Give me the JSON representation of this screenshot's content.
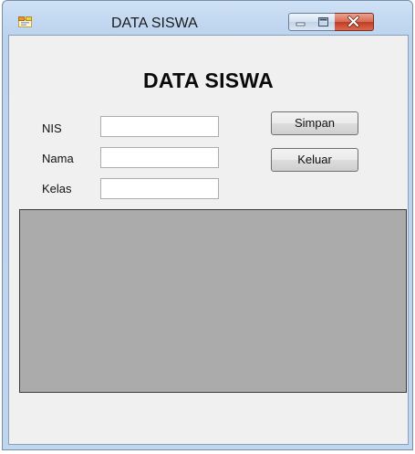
{
  "window": {
    "title": "DATA SISWA"
  },
  "form": {
    "heading": "DATA SISWA",
    "fields": [
      {
        "label": "NIS",
        "value": ""
      },
      {
        "label": "Nama",
        "value": ""
      },
      {
        "label": "Kelas",
        "value": ""
      }
    ],
    "buttons": {
      "save": "Simpan",
      "exit": "Keluar"
    }
  },
  "colors": {
    "grid_background": "#ababab",
    "form_background": "#f0f0f0",
    "close_button": "#c94b2f"
  },
  "icons": [
    "app-form-icon",
    "minimize-icon",
    "maximize-icon",
    "close-icon"
  ]
}
